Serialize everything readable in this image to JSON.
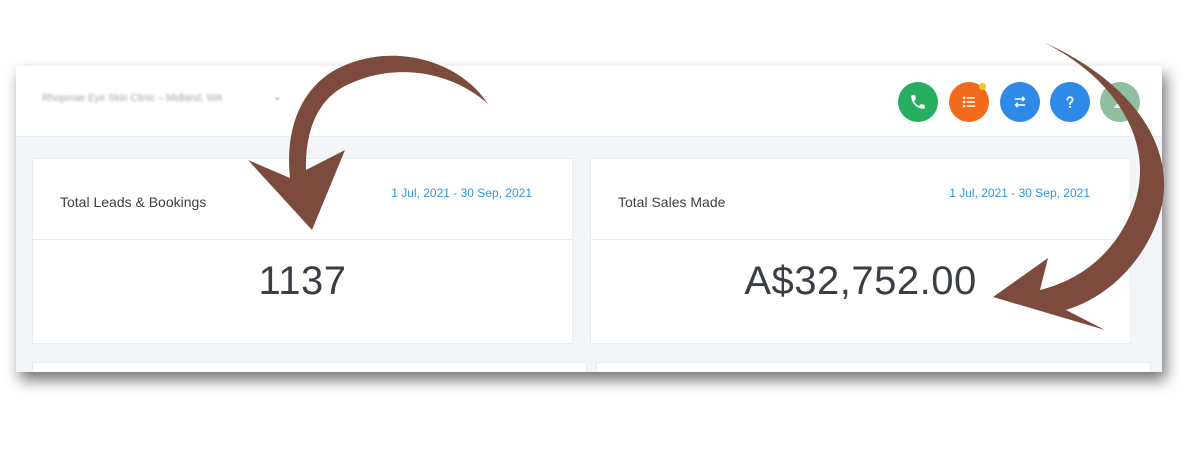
{
  "header": {
    "location_label": "Rhopmae Eye Skin Clinic – Midland, WA",
    "location_chevron": "⌄",
    "buttons": [
      {
        "name": "call",
        "icon": "phone-icon",
        "color": "#27ae60"
      },
      {
        "name": "tasks",
        "icon": "list-icon",
        "color": "#f26b1d",
        "has_notification": true
      },
      {
        "name": "switch",
        "icon": "swap-icon",
        "color": "#2e8ae6"
      },
      {
        "name": "help",
        "icon": "question-icon",
        "color": "#2e8ae6"
      },
      {
        "name": "account",
        "icon": "avatar-icon",
        "color": "#8fbf9f"
      }
    ]
  },
  "cards": [
    {
      "title": "Total Leads & Bookings",
      "date_range": "1 Jul, 2021 - 30 Sep, 2021",
      "value": "1137"
    },
    {
      "title": "Total Sales Made",
      "date_range": "1 Jul, 2021 - 30 Sep, 2021",
      "value": "A$32,752.00"
    }
  ],
  "annotations": {
    "arrow_color": "#7d4a3e"
  }
}
